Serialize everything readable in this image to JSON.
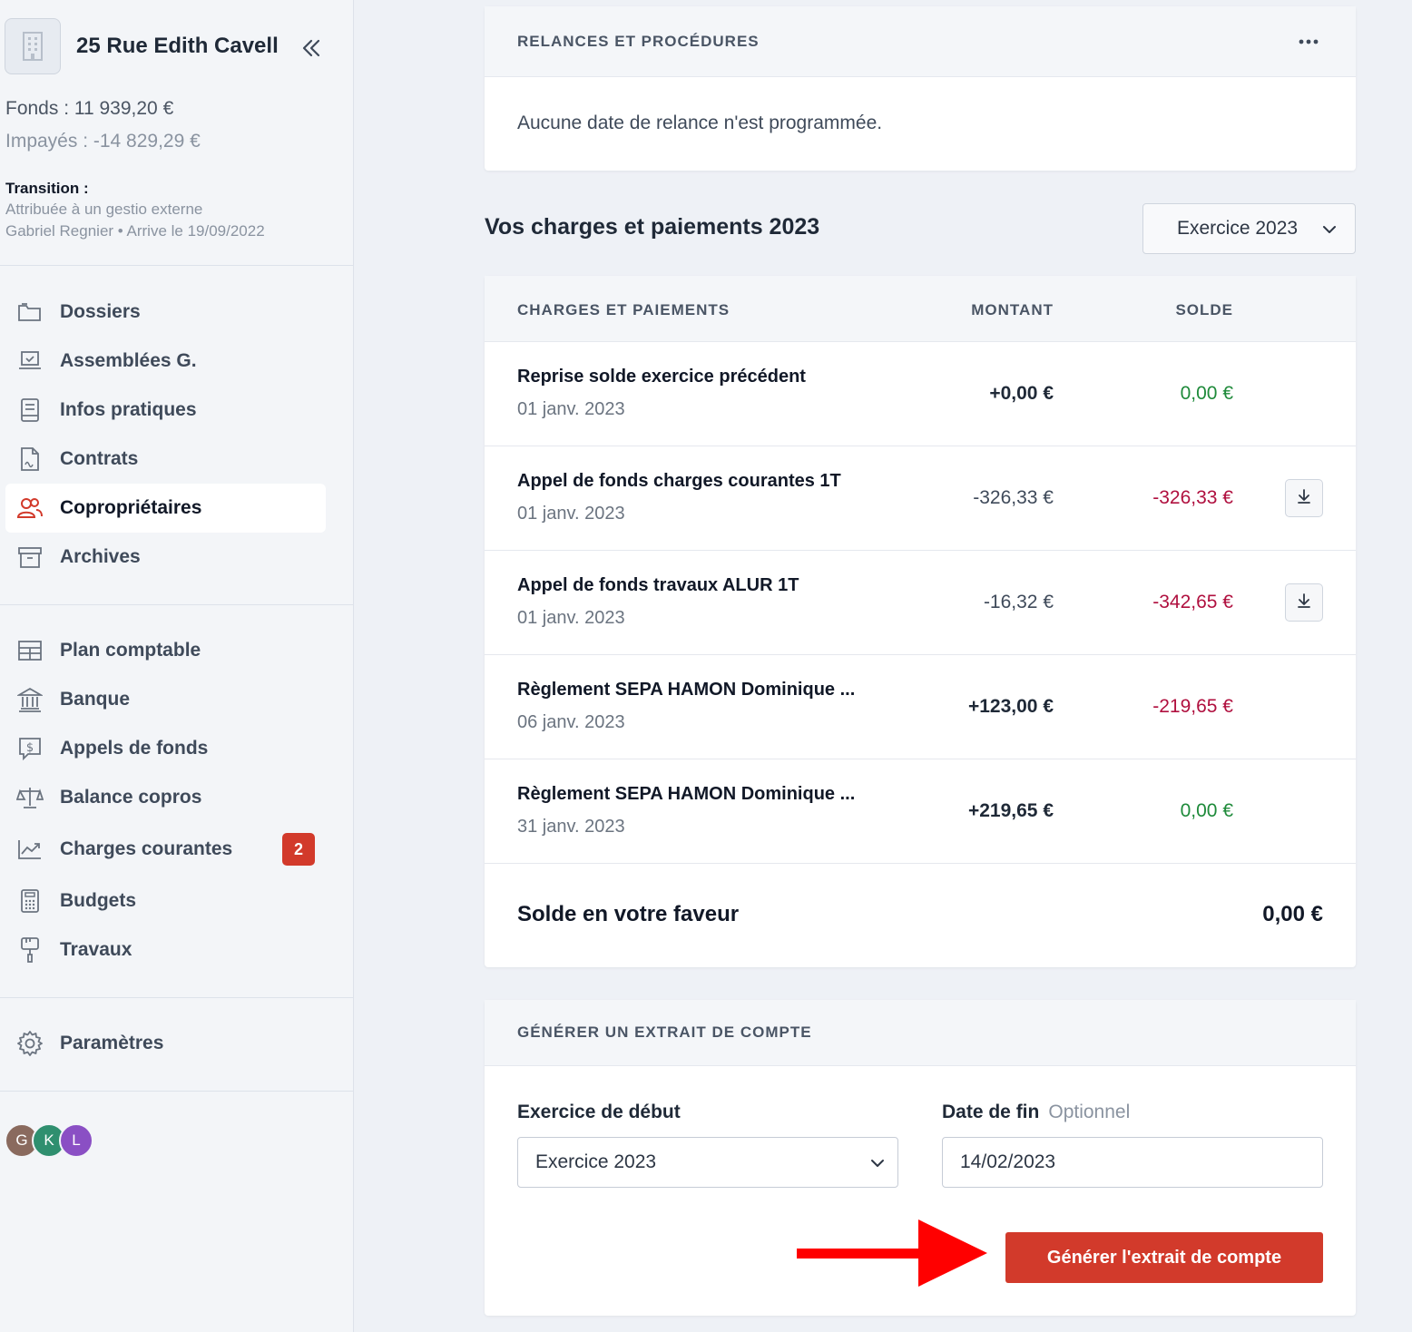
{
  "sidebar": {
    "building_name": "25 Rue Edith Cavell",
    "fonds": "Fonds : 11 939,20 €",
    "impayes": "Impayés : -14 829,29 €",
    "transition_title": "Transition :",
    "transition_line1": "Attribuée à un gestio externe",
    "transition_line2": "Gabriel Regnier • Arrive le 19/09/2022",
    "nav_primary": [
      {
        "label": "Dossiers",
        "icon": "folder-icon"
      },
      {
        "label": "Assemblées G.",
        "icon": "laptop-check-icon"
      },
      {
        "label": "Infos pratiques",
        "icon": "book-icon"
      },
      {
        "label": "Contrats",
        "icon": "document-signature-icon"
      },
      {
        "label": "Copropriétaires",
        "icon": "users-icon",
        "active": true
      },
      {
        "label": "Archives",
        "icon": "archive-box-icon"
      }
    ],
    "nav_secondary": [
      {
        "label": "Plan comptable",
        "icon": "table-icon"
      },
      {
        "label": "Banque",
        "icon": "bank-icon"
      },
      {
        "label": "Appels de fonds",
        "icon": "dollar-bubble-icon"
      },
      {
        "label": "Balance copros",
        "icon": "scale-icon"
      },
      {
        "label": "Charges courantes",
        "icon": "trend-chart-icon",
        "badge": "2"
      },
      {
        "label": "Budgets",
        "icon": "calculator-icon"
      },
      {
        "label": "Travaux",
        "icon": "paint-roller-icon"
      }
    ],
    "settings_label": "Paramètres",
    "avatars": [
      {
        "letter": "G",
        "color": "#8a6a5e"
      },
      {
        "letter": "K",
        "color": "#2f8f6f"
      },
      {
        "letter": "L",
        "color": "#8a4fc4"
      }
    ]
  },
  "relances": {
    "title": "RELANCES ET PROCÉDURES",
    "text": "Aucune date de relance n'est programmée."
  },
  "charges": {
    "section_title": "Vos charges et paiements 2023",
    "year_select": "Exercice 2023",
    "headers": {
      "label": "CHARGES ET PAIEMENTS",
      "amount": "MONTANT",
      "balance": "SOLDE"
    },
    "rows": [
      {
        "label": "Reprise solde exercice précédent",
        "date": "01 janv. 2023",
        "amount": "+0,00 €",
        "balance": "0,00 €",
        "balance_color": "#1e8a3a",
        "amount_bold": true,
        "download": false
      },
      {
        "label": "Appel de fonds charges courantes 1T",
        "date": "01 janv. 2023",
        "amount": "-326,33 €",
        "balance": "-326,33 €",
        "balance_color": "#b0103f",
        "amount_bold": false,
        "download": true
      },
      {
        "label": "Appel de fonds travaux ALUR 1T",
        "date": "01 janv. 2023",
        "amount": "-16,32 €",
        "balance": "-342,65 €",
        "balance_color": "#b0103f",
        "amount_bold": false,
        "download": true
      },
      {
        "label": "Règlement SEPA HAMON Dominique ...",
        "date": "06 janv. 2023",
        "amount": "+123,00 €",
        "balance": "-219,65 €",
        "balance_color": "#b0103f",
        "amount_bold": true,
        "download": false
      },
      {
        "label": "Règlement SEPA HAMON Dominique ...",
        "date": "31 janv. 2023",
        "amount": "+219,65 €",
        "balance": "0,00 €",
        "balance_color": "#1e8a3a",
        "amount_bold": true,
        "download": false
      }
    ],
    "total_label": "Solde en votre faveur",
    "total_value": "0,00 €"
  },
  "extrait": {
    "title": "GÉNÉRER UN EXTRAIT DE COMPTE",
    "start_label": "Exercice de début",
    "start_value": "Exercice 2023",
    "end_label": "Date de fin",
    "end_optional": "Optionnel",
    "end_value": "14/02/2023",
    "button": "Générer l'extrait de compte"
  },
  "colors": {
    "accent": "#d23a2b",
    "positive": "#1e8a3a",
    "negative": "#b0103f",
    "annotation_arrow": "#ff0000"
  }
}
